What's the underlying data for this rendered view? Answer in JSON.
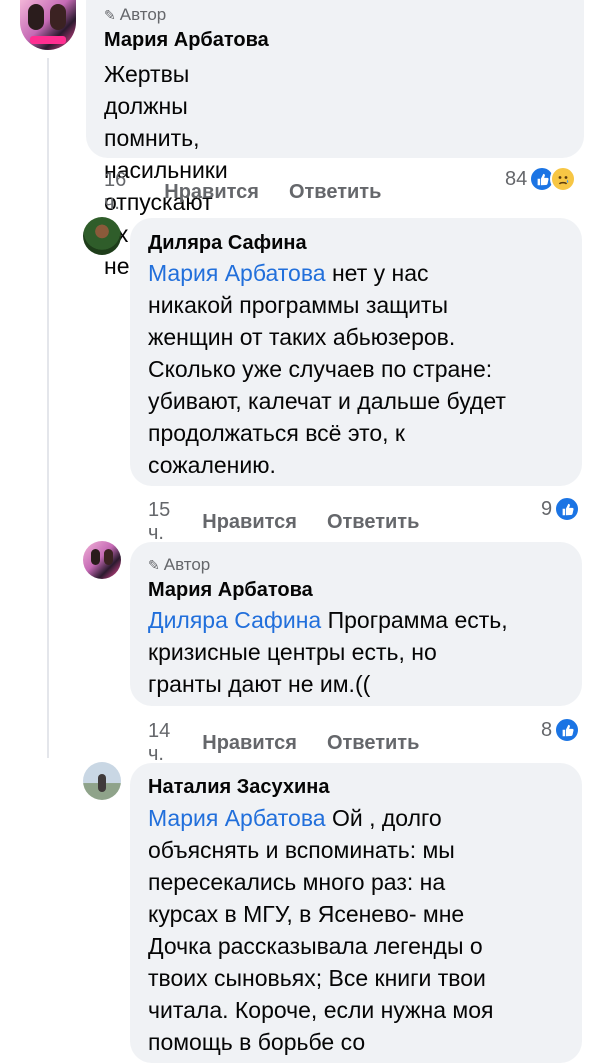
{
  "comments": [
    {
      "author_badge": "Автор",
      "name": "Мария Арбатова",
      "mention": "",
      "text": "Жертвы должны помнить, насильники отпускают их крайне неохотно!(",
      "lines": [
        "Жертвы должны помнить,",
        "насильники отпускают их крайне",
        "неохотно!("
      ],
      "time": "16 ч.",
      "like_label": "Нравится",
      "reply_label": "Ответить",
      "reaction_count": "84",
      "reactions": [
        "like-icon",
        "sad-icon"
      ]
    },
    {
      "author_badge": "",
      "name": "Диляра Сафина",
      "mention": "Мария Арбатова",
      "lines": [
        " нет у нас",
        "никакой программы защиты",
        "женщин от таких абьюзеров.",
        "Сколько уже случаев по стране:",
        "убивают, калечат и дальше будет",
        "продолжаться всё это, к",
        "сожалению."
      ],
      "time": "15 ч.",
      "like_label": "Нравится",
      "reply_label": "Ответить",
      "reaction_count": "9",
      "reactions": [
        "like-icon"
      ]
    },
    {
      "author_badge": "Автор",
      "name": "Мария Арбатова",
      "mention": "Диляра Сафина",
      "lines": [
        " Программа есть,",
        "кризисные центры есть, но",
        "гранты дают не им.(("
      ],
      "time": "14 ч.",
      "like_label": "Нравится",
      "reply_label": "Ответить",
      "reaction_count": "8",
      "reactions": [
        "like-icon"
      ]
    },
    {
      "author_badge": "",
      "name": "Наталия Засухина",
      "mention": "Мария Арбатова",
      "lines": [
        " Ой  , долго",
        "объяснять и вспоминать:  мы",
        "пересекались много раз: на",
        "курсах в МГУ, в Ясенево- мне",
        "Дочка рассказывала легенды о",
        "твоих сыновьях; Все книги твои",
        "читала. Короче, если нужна моя",
        "помощь в борьбе со"
      ]
    }
  ],
  "colors": {
    "bubble": "#f0f2f5",
    "mention": "#216fdb",
    "meta": "#65676b",
    "like": "#1b74e4"
  }
}
